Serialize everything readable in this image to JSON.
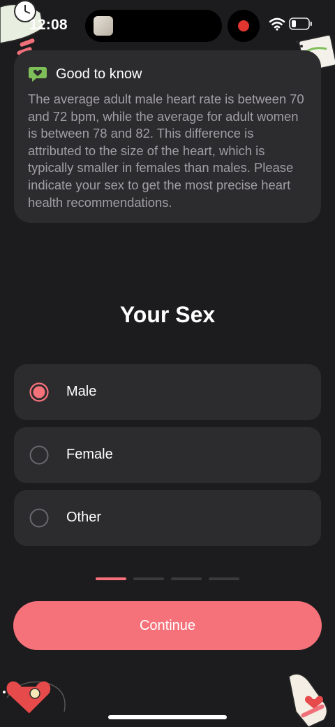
{
  "status_bar": {
    "time": "12:08",
    "recording_color": "#e0362f",
    "icons": [
      "wifi-icon",
      "battery-icon"
    ]
  },
  "info_card": {
    "title": "Good to know",
    "icon": "heart-chat-icon",
    "icon_color": "#7fbf5a",
    "body": "The average adult male heart rate is between 70 and 72 bpm, while the average for adult women is between 78 and 82. This difference is attributed to the size of the heart, which is typically smaller in females than males. Please indicate your sex to get the most precise heart health recommendations."
  },
  "question": {
    "title": "Your Sex"
  },
  "options": [
    {
      "label": "Male",
      "selected": true
    },
    {
      "label": "Female",
      "selected": false
    },
    {
      "label": "Other",
      "selected": false
    }
  ],
  "progress": {
    "current_step": 1,
    "total_steps": 4
  },
  "continue_button": {
    "label": "Continue"
  },
  "colors": {
    "background": "#1c1b1d",
    "card": "#2c2b2e",
    "accent": "#f6727b",
    "body_text": "#a19fa4"
  }
}
